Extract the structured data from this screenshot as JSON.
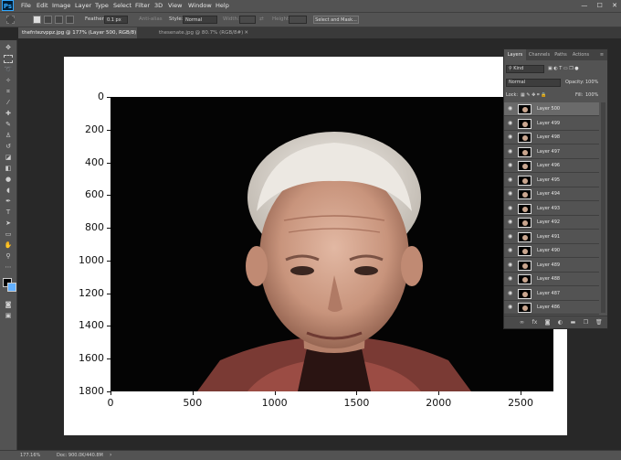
{
  "app": {
    "logo": "Ps"
  },
  "menu": [
    "File",
    "Edit",
    "Image",
    "Layer",
    "Type",
    "Select",
    "Filter",
    "3D",
    "View",
    "Window",
    "Help"
  ],
  "window_controls": {
    "minimize": "—",
    "maximize": "☐",
    "close": "✕"
  },
  "options": {
    "feather_label": "Feather:",
    "feather_value": "0.1 px",
    "anti_alias_label": "Anti-alias",
    "style_label": "Style:",
    "style_value": "Normal",
    "width_label": "Width:",
    "height_label": "Height:",
    "select_mask_label": "Select and Mask..."
  },
  "tabs": [
    {
      "label": "thefntezvppz.jpg @ 177% (Layer 500, RGB/8) *",
      "close": "✕"
    },
    {
      "label": "thesenate.jpg @ 80.7% (RGB/8#)",
      "close": "✕"
    }
  ],
  "chart_data": {
    "type": "heatmap",
    "title": "",
    "xlabel": "",
    "ylabel": "",
    "x_ticks": [
      0,
      500,
      1000,
      1500,
      2000,
      2500
    ],
    "y_ticks": [
      0,
      200,
      400,
      600,
      800,
      1000,
      1200,
      1400,
      1600,
      1800
    ],
    "xlim": [
      0,
      2700
    ],
    "ylim": [
      1800,
      0
    ],
    "grid": false
  },
  "layers_panel": {
    "tabs": [
      "Layers",
      "Channels",
      "Paths",
      "Actions"
    ],
    "kind_label": "Kind",
    "blend_mode": "Normal",
    "opacity_label": "Opacity:",
    "opacity_value": "100%",
    "lock_label": "Lock:",
    "fill_label": "Fill:",
    "fill_value": "100%",
    "layers": [
      "Layer 500",
      "Layer 499",
      "Layer 498",
      "Layer 497",
      "Layer 496",
      "Layer 495",
      "Layer 494",
      "Layer 493",
      "Layer 492",
      "Layer 491",
      "Layer 490",
      "Layer 489",
      "Layer 488",
      "Layer 487",
      "Layer 486"
    ]
  },
  "status": {
    "zoom": "177.16%",
    "doc": "Doc: 900.0K/440.8M"
  },
  "colors": {
    "foreground": "#000000",
    "background": "#ffffff",
    "accent": "#31a8ff"
  }
}
